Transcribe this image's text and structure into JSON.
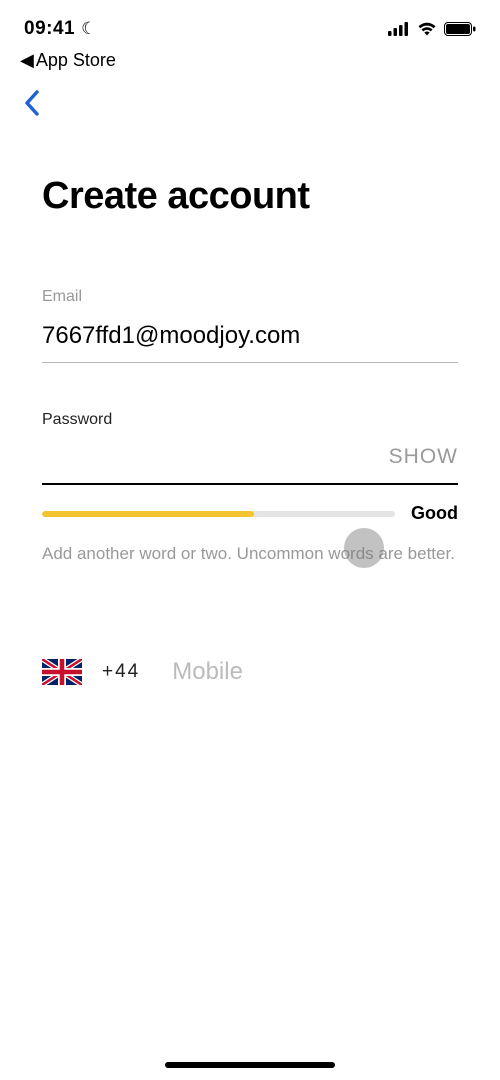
{
  "status": {
    "time": "09:41",
    "moon": "☾"
  },
  "breadcrumb": {
    "caret": "◀",
    "label": "App Store"
  },
  "page": {
    "title": "Create account"
  },
  "email": {
    "label": "Email",
    "value": "7667ffd1@moodjoy.com"
  },
  "password": {
    "label": "Password",
    "show": "SHOW",
    "value": ""
  },
  "strength": {
    "percent": 60,
    "label": "Good",
    "hint": "Add another word or two. Uncommon words are better.",
    "fill_color": "#f4c430"
  },
  "mobile": {
    "code": "+44",
    "placeholder": "Mobile"
  }
}
